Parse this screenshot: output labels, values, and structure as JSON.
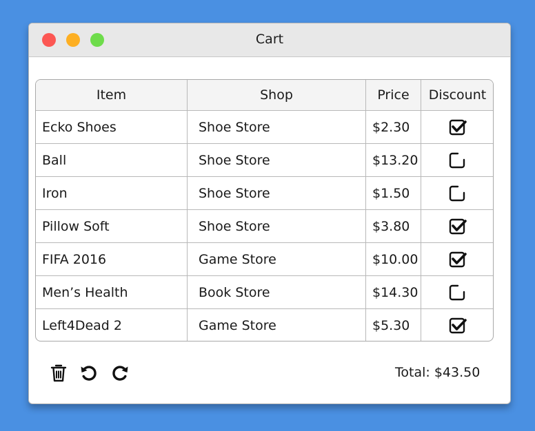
{
  "window": {
    "title": "Cart"
  },
  "table": {
    "headers": [
      "Item",
      "Shop",
      "Price",
      "Discount"
    ],
    "rows": [
      {
        "item": "Ecko Shoes",
        "shop": "Shoe Store",
        "price": "$2.30",
        "discount": true
      },
      {
        "item": "Ball",
        "shop": "Shoe Store",
        "price": "$13.20",
        "discount": false
      },
      {
        "item": "Iron",
        "shop": "Shoe Store",
        "price": "$1.50",
        "discount": false
      },
      {
        "item": "Pillow Soft",
        "shop": "Shoe Store",
        "price": "$3.80",
        "discount": true
      },
      {
        "item": "FIFA 2016",
        "shop": "Game Store",
        "price": "$10.00",
        "discount": true
      },
      {
        "item": "Men’s Health",
        "shop": "Book Store",
        "price": "$14.30",
        "discount": false
      },
      {
        "item": "Left4Dead 2",
        "shop": "Game Store",
        "price": "$5.30",
        "discount": true
      }
    ]
  },
  "toolbar": {
    "delete_icon": "trash-icon",
    "undo_icon": "undo-icon",
    "redo_icon": "redo-icon"
  },
  "footer": {
    "total": "Total: $43.50"
  },
  "colors": {
    "background": "#4a90e2",
    "close": "#fc5753",
    "minimize": "#fdaf23",
    "maximize": "#6edc4b"
  }
}
